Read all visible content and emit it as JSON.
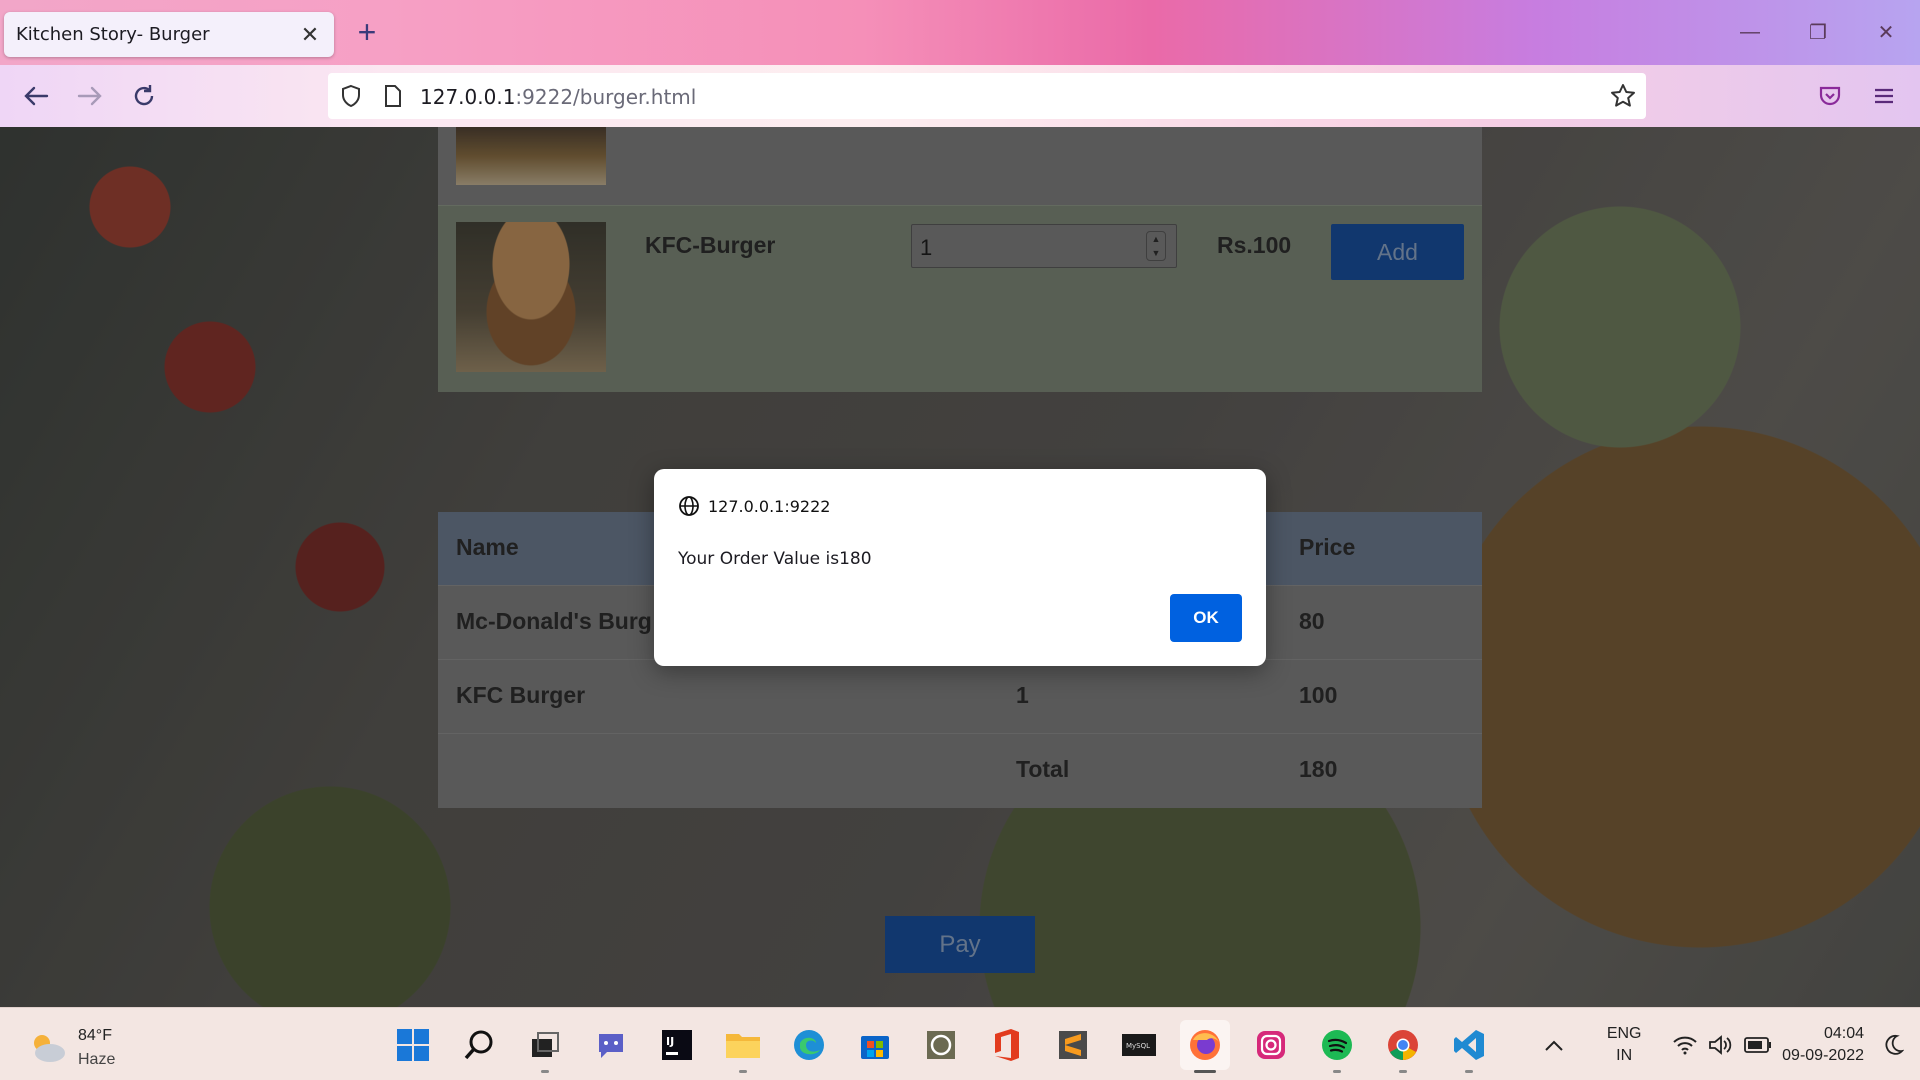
{
  "browser": {
    "tab_title": "Kitchen Story- Burger",
    "url_host": "127.0.0.1",
    "url_path": ":9222/burger.html"
  },
  "menu": {
    "item": {
      "name": "KFC-Burger",
      "quantity": "1",
      "price": "Rs.100",
      "add_label": "Add"
    }
  },
  "order": {
    "headers": [
      "Name",
      "Price"
    ],
    "rows": [
      {
        "name": "Mc-Donald's Burg",
        "qty": "",
        "price": "80"
      },
      {
        "name": "KFC Burger",
        "qty": "1",
        "price": "100"
      },
      {
        "name": "",
        "qty": "Total",
        "price": "180"
      }
    ],
    "pay_label": "Pay"
  },
  "dialog": {
    "origin": "127.0.0.1:9222",
    "message": "Your Order Value is180",
    "ok_label": "OK"
  },
  "taskbar": {
    "weather_temp": "84°F",
    "weather_desc": "Haze",
    "lang_line1": "ENG",
    "lang_line2": "IN",
    "time": "04:04",
    "date": "09-09-2022",
    "apps": [
      "start-icon",
      "search-icon",
      "task-view-icon",
      "chat-icon",
      "intellij-icon",
      "file-explorer-icon",
      "edge-icon",
      "store-icon",
      "app-icon",
      "office-icon",
      "sublime-icon",
      "mysql-icon",
      "firefox-icon",
      "instagram-icon",
      "spotify-icon",
      "chrome-icon",
      "vscode-icon"
    ]
  },
  "colors": {
    "accent_blue": "#0061e0",
    "button_blue": "#0a48a0"
  }
}
